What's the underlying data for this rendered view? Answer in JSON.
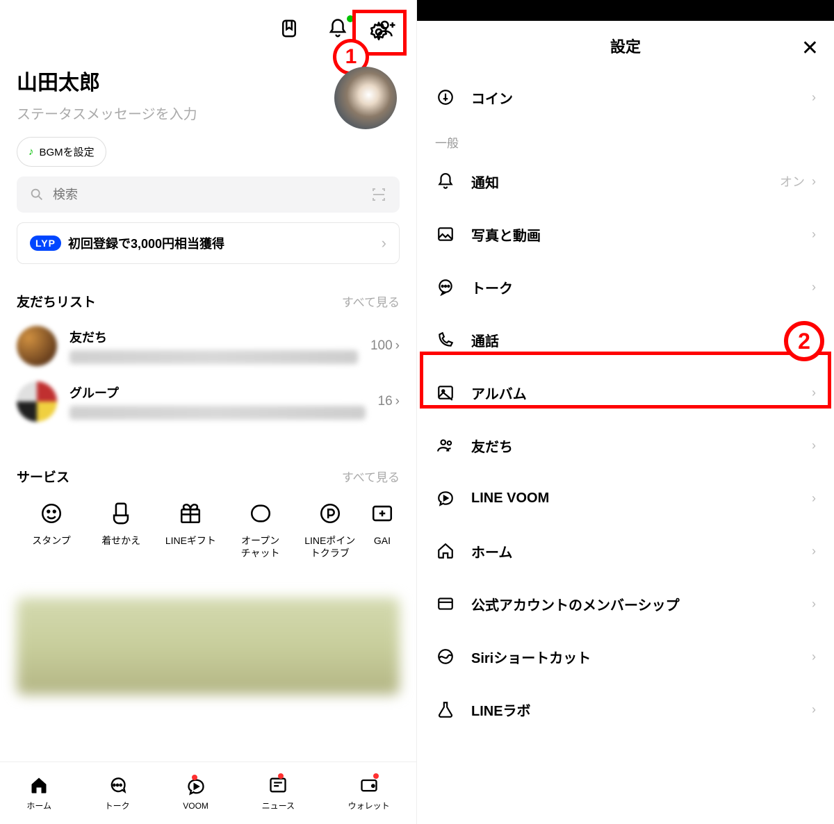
{
  "annotations": {
    "one": "1",
    "two": "2"
  },
  "left": {
    "profile": {
      "name": "山田太郎",
      "status": "ステータスメッセージを入力",
      "bgm": "BGMを設定"
    },
    "search": {
      "placeholder": "検索"
    },
    "promo": {
      "tag": "LYP",
      "text": "初回登録で3,000円相当獲得"
    },
    "friends": {
      "title": "友だちリスト",
      "see_all": "すべて見る",
      "items": [
        {
          "label": "友だち",
          "count": "100"
        },
        {
          "label": "グループ",
          "count": "16"
        }
      ]
    },
    "services": {
      "title": "サービス",
      "see_all": "すべて見る",
      "items": [
        {
          "label": "スタンプ"
        },
        {
          "label": "着せかえ"
        },
        {
          "label": "LINEギフト"
        },
        {
          "label": "オープン\nチャット"
        },
        {
          "label": "LINEポイン\nトクラブ"
        },
        {
          "label": "GAI"
        }
      ]
    },
    "tabs": [
      {
        "label": "ホーム"
      },
      {
        "label": "トーク"
      },
      {
        "label": "VOOM"
      },
      {
        "label": "ニュース"
      },
      {
        "label": "ウォレット"
      }
    ]
  },
  "right": {
    "title": "設定",
    "cat_general": "一般",
    "rows": {
      "coin": "コイン",
      "notif": {
        "label": "通知",
        "value": "オン"
      },
      "photo": "写真と動画",
      "talk": "トーク",
      "call": "通話",
      "album": "アルバム",
      "friends": "友だち",
      "voom": "LINE VOOM",
      "home": "ホーム",
      "membership": "公式アカウントのメンバーシップ",
      "siri": "Siriショートカット",
      "lab": "LINEラボ"
    }
  }
}
